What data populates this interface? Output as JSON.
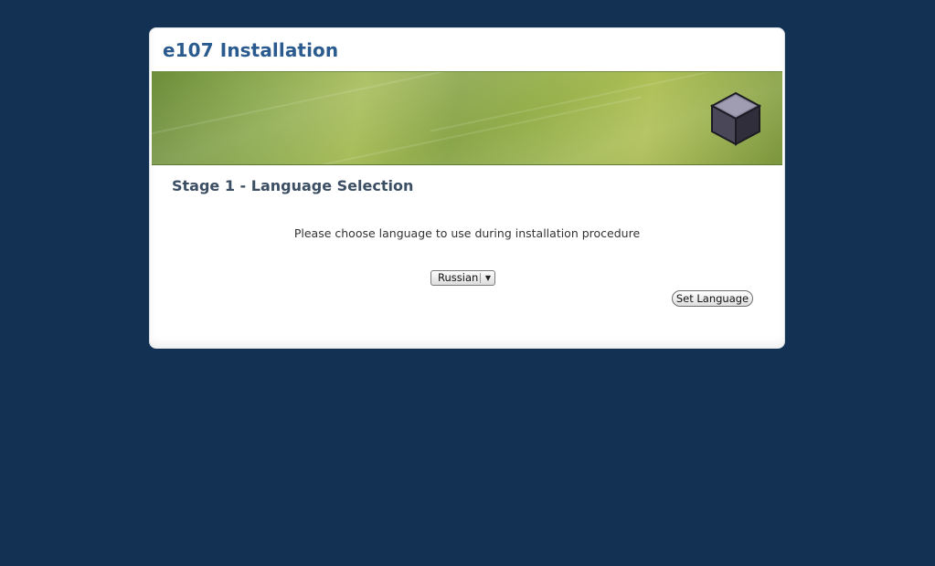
{
  "installer": {
    "title": "e107 Installation"
  },
  "stage": {
    "title": "Stage 1 - Language Selection",
    "prompt": "Please choose language to use during installation procedure"
  },
  "language_select": {
    "selected": "Russian",
    "icon": "chevron-down-icon"
  },
  "actions": {
    "set_language_label": "Set Language"
  },
  "banner": {
    "logo_icon": "cube-icon"
  },
  "colors": {
    "background": "#133152",
    "title": "#2b5b8e",
    "stage_title": "#3b4e63"
  }
}
